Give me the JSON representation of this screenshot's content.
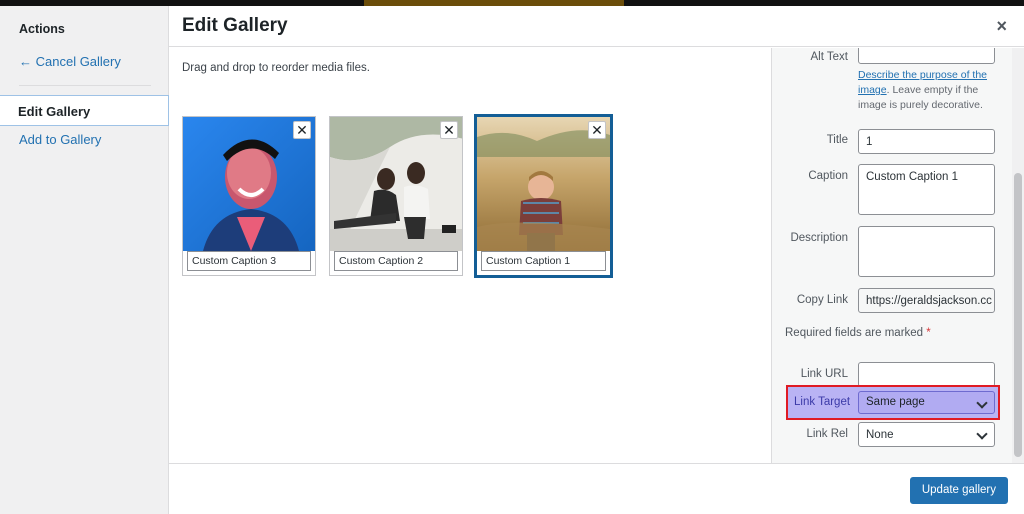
{
  "menu": {
    "heading": "Actions",
    "cancel": "← Cancel Gallery",
    "edit": "Edit Gallery",
    "add": "Add to Gallery"
  },
  "header": {
    "title": "Edit Gallery",
    "close": "×"
  },
  "content": {
    "instructions": "Drag and drop to reorder media files.",
    "attachments": [
      {
        "caption": "Custom Caption 3",
        "selected": false
      },
      {
        "caption": "Custom Caption 2",
        "selected": false
      },
      {
        "caption": "Custom Caption 1",
        "selected": true
      }
    ],
    "remove_glyph": "✕"
  },
  "sidebar": {
    "alt_label": "Alt Text",
    "alt_value": "",
    "alt_help_link": "Describe the purpose of the image",
    "alt_help_rest": ". Leave empty if the image is purely decorative.",
    "title_label": "Title",
    "title_value": "1",
    "caption_label": "Caption",
    "caption_value": "Custom Caption 1",
    "description_label": "Description",
    "description_value": "",
    "copy_link_label": "Copy Link",
    "copy_link_value": "https://geraldsjackson.cc",
    "required_text": "Required fields are marked ",
    "required_star": "*",
    "link_url_label": "Link URL",
    "link_url_value": "",
    "link_target_label": "Link Target",
    "link_target_value": "Same page",
    "link_rel_label": "Link Rel",
    "link_rel_value": "None"
  },
  "toolbar": {
    "update_label": "Update gallery"
  },
  "colors": {
    "accent": "#2271b1",
    "highlight": "#b9b3f4",
    "highlight_border": "#e01b24"
  }
}
